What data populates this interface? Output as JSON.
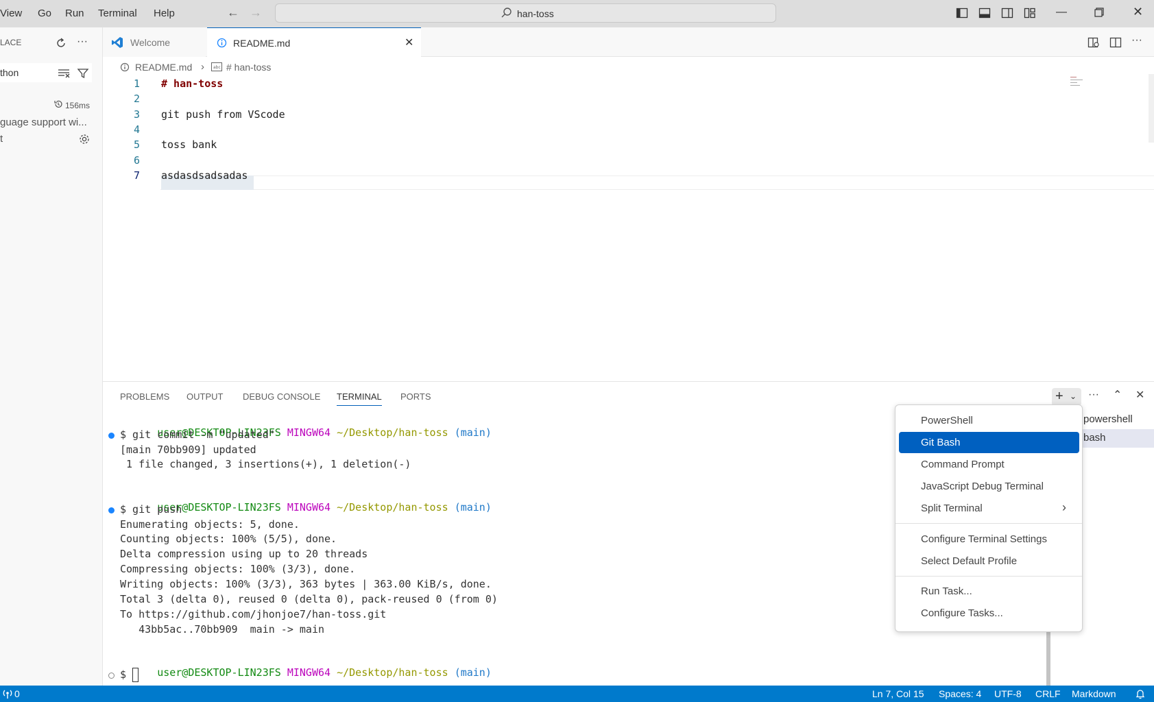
{
  "titlebar": {
    "menu": [
      "View",
      "Go",
      "Run",
      "Terminal",
      "Help"
    ],
    "search_text": "han-toss",
    "icons": [
      "arrow-left-icon",
      "arrow-right-icon",
      "toggle-sidebar-icon",
      "toggle-panel-icon",
      "toggle-secondary-sidebar-icon",
      "customize-layout-icon",
      "minimize-icon",
      "restore-icon",
      "close-icon"
    ]
  },
  "sidebar": {
    "header": "LACE",
    "filter_text": "thon",
    "timing": "156ms",
    "desc": "guage support wi...",
    "line3": "t"
  },
  "tabs": [
    {
      "label": "Welcome"
    },
    {
      "label": "README.md"
    }
  ],
  "breadcrumb": {
    "file": "README.md",
    "symbol": "# han-toss"
  },
  "editor": {
    "lines": [
      {
        "no": "1",
        "text": "# han-toss"
      },
      {
        "no": "2",
        "text": ""
      },
      {
        "no": "3",
        "text": "git push from VScode"
      },
      {
        "no": "4",
        "text": ""
      },
      {
        "no": "5",
        "text": "toss bank"
      },
      {
        "no": "6",
        "text": ""
      },
      {
        "no": "7",
        "text": "asdasdsadsadas"
      }
    ]
  },
  "panel": {
    "tabs": [
      "PROBLEMS",
      "OUTPUT",
      "DEBUG CONSOLE",
      "TERMINAL",
      "PORTS"
    ],
    "prompt": {
      "user": "user@DESKTOP-LIN23FS",
      "env": "MINGW64",
      "path": "~/Desktop/han-toss",
      "branch": "(main)"
    },
    "cmd1": "$ git commit -m \"updated\"",
    "out1": [
      "[main 70bb909] updated",
      " 1 file changed, 3 insertions(+), 1 deletion(-)"
    ],
    "cmd2": "$ git push",
    "out2": [
      "Enumerating objects: 5, done.",
      "Counting objects: 100% (5/5), done.",
      "Delta compression using up to 20 threads",
      "Compressing objects: 100% (3/3), done.",
      "Writing objects: 100% (3/3), 363 bytes | 363.00 KiB/s, done.",
      "Total 3 (delta 0), reused 0 (delta 0), pack-reused 0 (from 0)",
      "To https://github.com/jhonjoe7/han-toss.git",
      "   43bb5ac..70bb909  main -> main"
    ],
    "cmd3": "$ "
  },
  "dropdown": {
    "items": [
      "PowerShell",
      "Git Bash",
      "Command Prompt",
      "JavaScript Debug Terminal",
      "Split Terminal"
    ],
    "items2": [
      "Configure Terminal Settings",
      "Select Default Profile"
    ],
    "items3": [
      "Run Task...",
      "Configure Tasks..."
    ]
  },
  "terminal_list": [
    "powershell",
    "bash"
  ],
  "statusbar": {
    "ports": "0",
    "position": "Ln 7, Col 15",
    "spaces": "Spaces: 4",
    "encoding": "UTF-8",
    "eol": "CRLF",
    "language": "Markdown"
  }
}
